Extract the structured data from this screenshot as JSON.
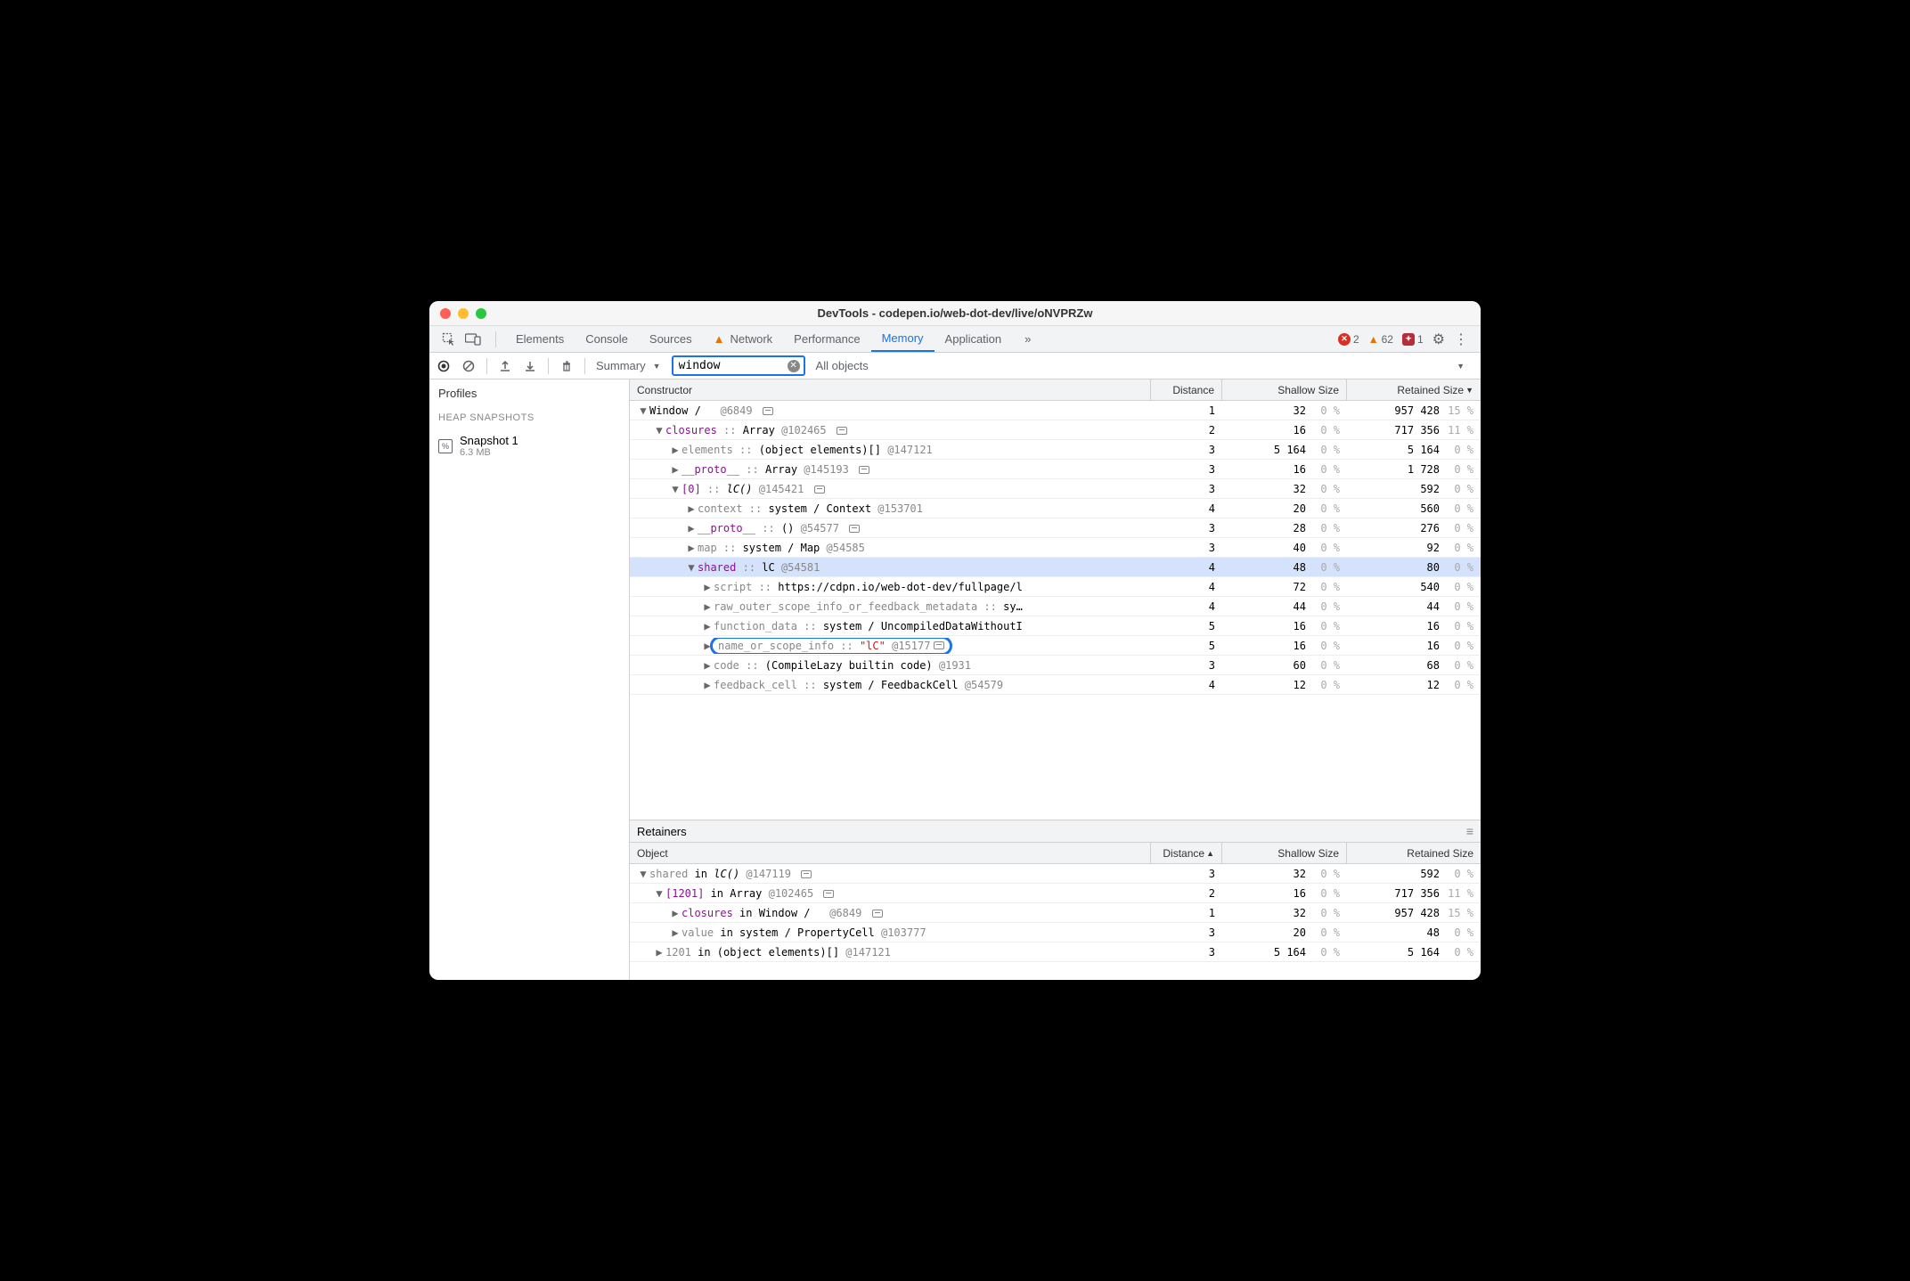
{
  "title": "DevTools - codepen.io/web-dot-dev/live/oNVPRZw",
  "tabs": {
    "items": [
      "Elements",
      "Console",
      "Sources",
      "Network",
      "Performance",
      "Memory",
      "Application"
    ],
    "active": "Memory",
    "warn_tab": "Network",
    "more": "»"
  },
  "badges": {
    "errors": "2",
    "warnings": "62",
    "ext": "1"
  },
  "toolbar": {
    "summary": "Summary",
    "filter_value": "window",
    "all_objects": "All objects"
  },
  "sidebar": {
    "profiles": "Profiles",
    "section": "HEAP SNAPSHOTS",
    "snapshot_name": "Snapshot 1",
    "snapshot_size": "6.3 MB"
  },
  "headers": {
    "constructor": "Constructor",
    "distance": "Distance",
    "shallow": "Shallow Size",
    "retained": "Retained Size",
    "object": "Object"
  },
  "retainers_label": "Retainers",
  "rows": [
    {
      "indent": 0,
      "exp": "▼",
      "html": "Window / &nbsp;&nbsp;<span class='gray'>@6849</span> <span class='link-icon'></span>",
      "d": "1",
      "ss": "32",
      "ssp": "0 %",
      "rs": "957 428",
      "rsp": "15 %"
    },
    {
      "indent": 1,
      "exp": "▼",
      "html": "<span class='purple'>closures</span> <span class='gray'>::</span> Array <span class='gray'>@102465</span> <span class='link-icon'></span>",
      "d": "2",
      "ss": "16",
      "ssp": "0 %",
      "rs": "717 356",
      "rsp": "11 %"
    },
    {
      "indent": 2,
      "exp": "▶",
      "html": "<span class='gray'>elements ::</span> (object elements)[] <span class='gray'>@147121</span>",
      "d": "3",
      "ss": "5 164",
      "ssp": "0 %",
      "rs": "5 164",
      "rsp": "0 %"
    },
    {
      "indent": 2,
      "exp": "▶",
      "html": "<span class='purple'>__proto__</span> <span class='gray'>::</span> Array <span class='gray'>@145193</span> <span class='link-icon'></span>",
      "d": "3",
      "ss": "16",
      "ssp": "0 %",
      "rs": "1 728",
      "rsp": "0 %"
    },
    {
      "indent": 2,
      "exp": "▼",
      "html": "<span class='purple'>[0]</span> <span class='gray'>::</span> <i>lC()</i> <span class='gray'>@145421</span> <span class='link-icon'></span>",
      "d": "3",
      "ss": "32",
      "ssp": "0 %",
      "rs": "592",
      "rsp": "0 %"
    },
    {
      "indent": 3,
      "exp": "▶",
      "html": "<span class='gray'>context ::</span> system / Context <span class='gray'>@153701</span>",
      "d": "4",
      "ss": "20",
      "ssp": "0 %",
      "rs": "560",
      "rsp": "0 %"
    },
    {
      "indent": 3,
      "exp": "▶",
      "html": "<span class='purple'>__proto__</span> <span class='gray'>::</span> () <span class='gray'>@54577</span> <span class='link-icon'></span>",
      "d": "3",
      "ss": "28",
      "ssp": "0 %",
      "rs": "276",
      "rsp": "0 %"
    },
    {
      "indent": 3,
      "exp": "▶",
      "html": "<span class='gray'>map ::</span> system / Map <span class='gray'>@54585</span>",
      "d": "3",
      "ss": "40",
      "ssp": "0 %",
      "rs": "92",
      "rsp": "0 %"
    },
    {
      "indent": 3,
      "exp": "▼",
      "html": "<span class='purple'>shared</span> <span class='gray'>::</span> lC <span class='gray'>@54581</span>",
      "d": "4",
      "ss": "48",
      "ssp": "0 %",
      "rs": "80",
      "rsp": "0 %",
      "sel": true
    },
    {
      "indent": 4,
      "exp": "▶",
      "html": "<span class='gray'>script ::</span> https://cdpn.io/web-dot-dev/fullpage/l",
      "d": "4",
      "ss": "72",
      "ssp": "0 %",
      "rs": "540",
      "rsp": "0 %"
    },
    {
      "indent": 4,
      "exp": "▶",
      "html": "<span class='gray'>raw_outer_scope_info_or_feedback_metadata ::</span> sy…",
      "d": "4",
      "ss": "44",
      "ssp": "0 %",
      "rs": "44",
      "rsp": "0 %"
    },
    {
      "indent": 4,
      "exp": "▶",
      "html": "<span class='gray'>function_data ::</span> system / UncompiledDataWithoutI",
      "d": "5",
      "ss": "16",
      "ssp": "0 %",
      "rs": "16",
      "rsp": "0 %"
    },
    {
      "indent": 4,
      "exp": "▶",
      "html": "<span class='highlight-ring'><span class='gray'>name_or_scope_info ::</span>&nbsp;<span class='red'>\"lC\"</span>&nbsp;<span class='gray'>@15177</span> <span class='link-icon'></span></span>",
      "d": "5",
      "ss": "16",
      "ssp": "0 %",
      "rs": "16",
      "rsp": "0 %"
    },
    {
      "indent": 4,
      "exp": "▶",
      "html": "<span class='gray'>code ::</span> (CompileLazy builtin code) <span class='gray'>@1931</span>",
      "d": "3",
      "ss": "60",
      "ssp": "0 %",
      "rs": "68",
      "rsp": "0 %"
    },
    {
      "indent": 4,
      "exp": "▶",
      "html": "<span class='gray'>feedback_cell ::</span> system / FeedbackCell <span class='gray'>@54579</span>",
      "d": "4",
      "ss": "12",
      "ssp": "0 %",
      "rs": "12",
      "rsp": "0 %"
    }
  ],
  "retainer_rows": [
    {
      "indent": 0,
      "exp": "▼",
      "html": "<span class='gray'>shared</span> in <i>lC()</i> <span class='gray'>@147119</span> <span class='link-icon'></span>",
      "d": "3",
      "ss": "32",
      "ssp": "0 %",
      "rs": "592",
      "rsp": "0 %"
    },
    {
      "indent": 1,
      "exp": "▼",
      "html": "<span class='purple'>[1201]</span> in Array <span class='gray'>@102465</span> <span class='link-icon'></span>",
      "d": "2",
      "ss": "16",
      "ssp": "0 %",
      "rs": "717 356",
      "rsp": "11 %"
    },
    {
      "indent": 2,
      "exp": "▶",
      "html": "<span class='purple'>closures</span> in Window / &nbsp;&nbsp;<span class='gray'>@6849</span> <span class='link-icon'></span>",
      "d": "1",
      "ss": "32",
      "ssp": "0 %",
      "rs": "957 428",
      "rsp": "15 %"
    },
    {
      "indent": 2,
      "exp": "▶",
      "html": "<span class='gray'>value</span> in system / PropertyCell <span class='gray'>@103777</span>",
      "d": "3",
      "ss": "20",
      "ssp": "0 %",
      "rs": "48",
      "rsp": "0 %"
    },
    {
      "indent": 1,
      "exp": "▶",
      "html": "<span class='gray'>1201</span> in (object elements)[] <span class='gray'>@147121</span>",
      "d": "3",
      "ss": "5 164",
      "ssp": "0 %",
      "rs": "5 164",
      "rsp": "0 %"
    }
  ]
}
